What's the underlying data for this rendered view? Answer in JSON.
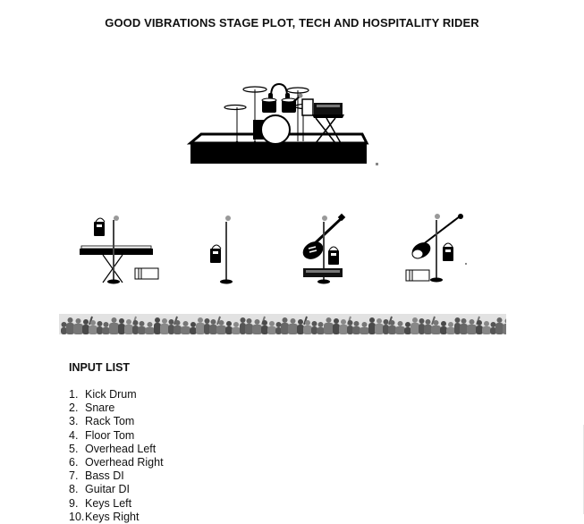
{
  "document": {
    "title": "GOOD VIBRATIONS STAGE PLOT, TECH AND HOSPITALITY RIDER"
  },
  "stage_plot": {
    "riser": {
      "label": "drum-riser",
      "items": [
        "drum-kit",
        "headphones",
        "vocal-mic",
        "tablet",
        "mixer-on-stand"
      ]
    },
    "positions": [
      {
        "name": "keys",
        "items": [
          "keyboard",
          "mic-stand",
          "in-ear-pack",
          "di-box"
        ]
      },
      {
        "name": "vocal",
        "items": [
          "mic-stand",
          "in-ear-pack"
        ]
      },
      {
        "name": "guitar",
        "items": [
          "electric-guitar",
          "mic-stand",
          "in-ear-pack",
          "pedalboard"
        ]
      },
      {
        "name": "bass",
        "items": [
          "bass-guitar",
          "mic-stand",
          "in-ear-pack",
          "di-box"
        ]
      }
    ],
    "audience_label": "audience-crowd"
  },
  "input_list": {
    "heading": "INPUT LIST",
    "items": [
      {
        "num": "1.",
        "label": "Kick Drum"
      },
      {
        "num": "2.",
        "label": "Snare"
      },
      {
        "num": "3.",
        "label": "Rack Tom"
      },
      {
        "num": "4.",
        "label": "Floor Tom"
      },
      {
        "num": "5.",
        "label": "Overhead Left"
      },
      {
        "num": "6.",
        "label": "Overhead Right"
      },
      {
        "num": "7.",
        "label": "Bass DI"
      },
      {
        "num": "8.",
        "label": "Guitar DI"
      },
      {
        "num": "9.",
        "label": "Keys Left"
      },
      {
        "num": "10.",
        "label": "Keys Right"
      }
    ]
  }
}
